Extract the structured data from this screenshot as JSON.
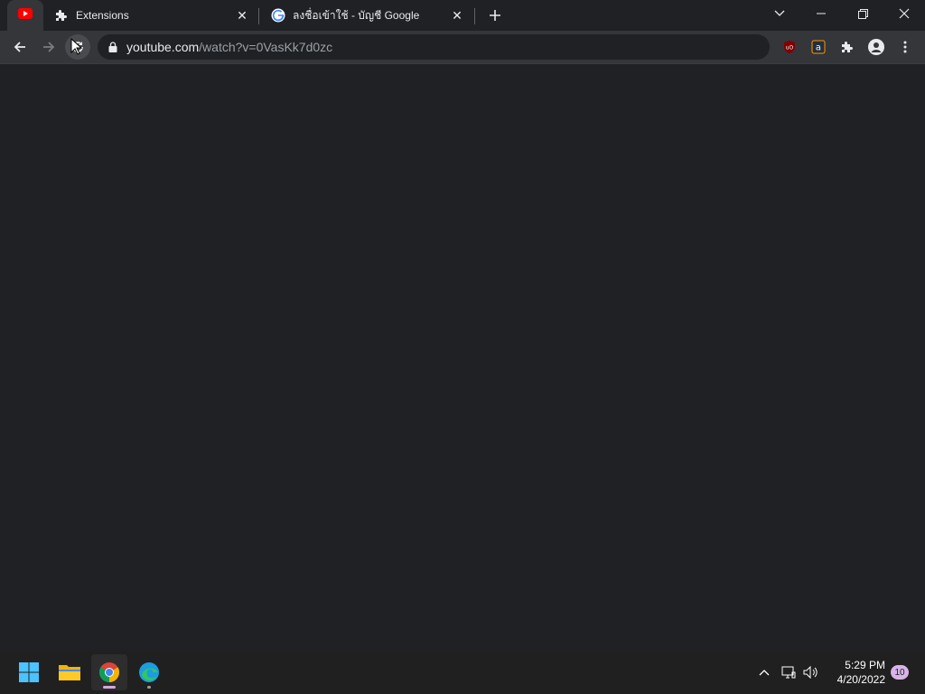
{
  "browser": {
    "tabs": [
      {
        "title": "",
        "favicon": "youtube-favicon",
        "active": true
      },
      {
        "title": "Extensions",
        "favicon": "puzzle-icon",
        "active": false
      },
      {
        "title": "ลงชื่อเข้าใช้ - บัญชี Google",
        "favicon": "google-g-icon",
        "active": false
      }
    ],
    "address": {
      "host": "youtube.com",
      "path": "/watch?v=0VasKk7d0zc"
    }
  },
  "taskbar": {
    "apps": [
      "windows-start-icon",
      "file-explorer-icon",
      "chrome-icon",
      "edge-icon"
    ],
    "clock": {
      "time": "5:29 PM",
      "date": "4/20/2022"
    },
    "notification_count": "10"
  },
  "colors": {
    "titlebar": "#202124",
    "toolbar": "#35363a",
    "content": "#202124",
    "taskbar": "#202020",
    "accent": "#d6a8e0"
  }
}
